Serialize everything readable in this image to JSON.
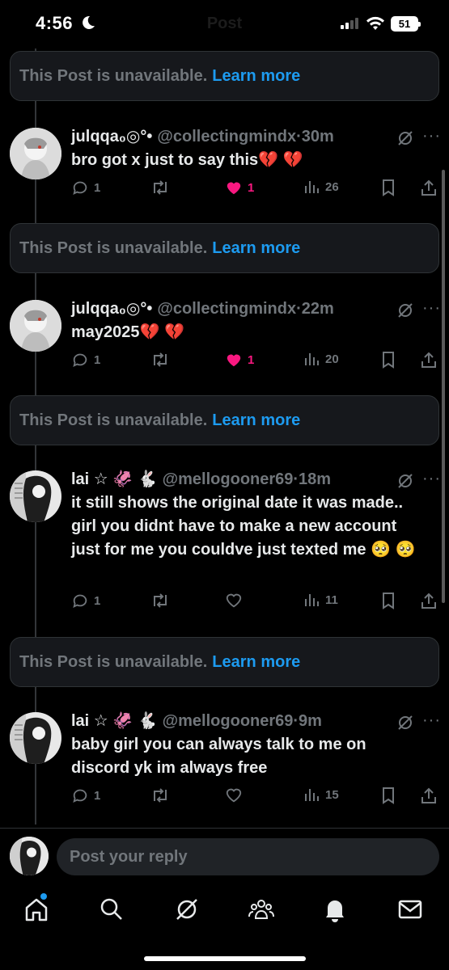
{
  "status": {
    "time": "4:56",
    "battery": "51",
    "ghost_title": "Post"
  },
  "unavailable_text": "This Post is unavailable.",
  "learn_more": "Learn more",
  "posts": [
    {
      "name": "julqqa₀◎°•",
      "handle": "@collectingmindx·30m",
      "text": "bro got x just to say this💔 💔",
      "replies": "1",
      "likes": "1",
      "views": "26",
      "liked": true
    },
    {
      "name": "julqqa₀◎°•",
      "handle": "@collectingmindx·22m",
      "text": "may2025💔 💔",
      "replies": "1",
      "likes": "1",
      "views": "20",
      "liked": true
    },
    {
      "name": "lai ☆ 🦑 🐇",
      "handle": "@mellogooner69·18m",
      "text": "it still shows the original date it was made.. girl you didnt have to make a new account just for me you couldve just texted me 🥺 🥺",
      "replies": "1",
      "likes": "",
      "views": "11",
      "liked": false
    },
    {
      "name": "lai ☆ 🦑 🐇",
      "handle": "@mellogooner69·9m",
      "text": "baby girl you can always talk to me on discord yk im always free",
      "replies": "1",
      "likes": "",
      "views": "15",
      "liked": false
    }
  ],
  "reply": {
    "placeholder": "Post your reply"
  },
  "tabs": [
    "home-icon",
    "search-icon",
    "grok-icon",
    "communities-icon",
    "notifications-icon",
    "messages-icon"
  ],
  "colors": {
    "accent": "#1d9bf0",
    "like": "#f91880",
    "muted": "#71767b",
    "card": "#16181c"
  }
}
